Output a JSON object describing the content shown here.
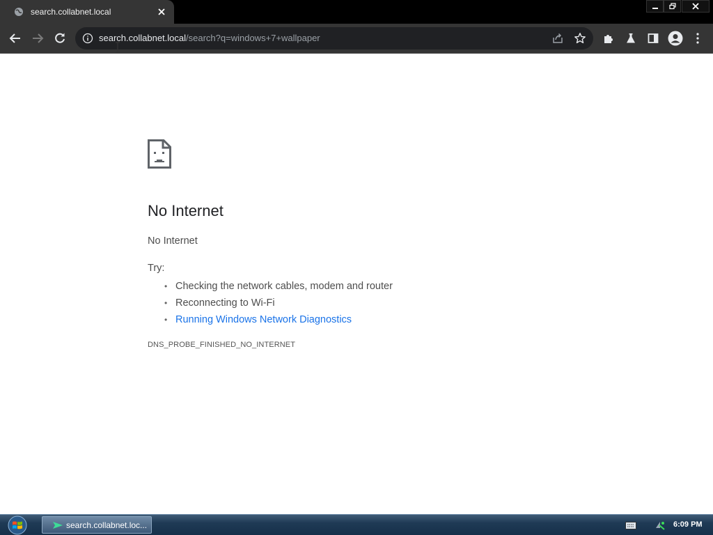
{
  "browser": {
    "tab": {
      "title": "search.collabnet.local"
    },
    "omnibox": {
      "host": "search.collabnet.local",
      "path": "/search?q=windows+7+wallpaper"
    }
  },
  "page": {
    "heading": "No Internet",
    "subtext": "No Internet",
    "try_label": "Try:",
    "suggestions": [
      "Checking the network cables, modem and router",
      "Reconnecting to Wi-Fi",
      "Running Windows Network Diagnostics"
    ],
    "error_code": "DNS_PROBE_FINISHED_NO_INTERNET"
  },
  "taskbar": {
    "task_label": "search.collabnet.loc...",
    "clock": "6:09 PM"
  },
  "colors": {
    "link": "#1a73e8",
    "toolbar_bg": "#353535",
    "taskbar_bg": "#1f3a55"
  },
  "icons": [
    "globe-icon",
    "close-icon",
    "minimize-icon",
    "maximize-icon",
    "window-close-icon",
    "back-icon",
    "forward-icon",
    "reload-icon",
    "info-icon",
    "share-icon",
    "star-icon",
    "extensions-icon",
    "flask-icon",
    "side-panel-icon",
    "profile-icon",
    "menu-icon",
    "sad-document-icon",
    "windows-start-icon",
    "network-icon",
    "keyboard-icon"
  ]
}
